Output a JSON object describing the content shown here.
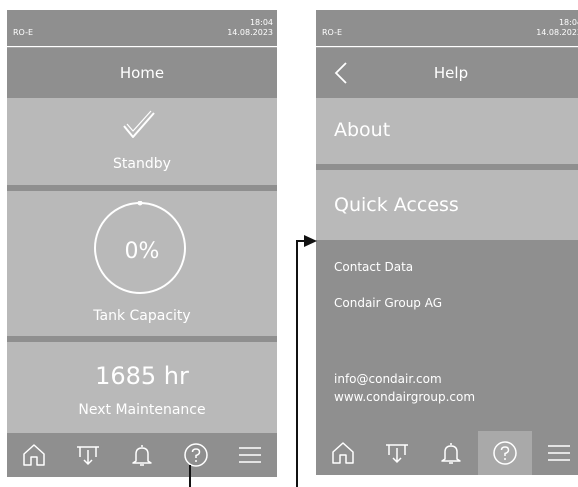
{
  "left_screen": {
    "status": {
      "model": "RO-E",
      "time": "18:04",
      "date": "14.08.2023"
    },
    "title": "Home",
    "standby_label": "Standby",
    "tank": {
      "value": "0%",
      "label": "Tank Capacity",
      "fill_fraction": 0.0
    },
    "maintenance": {
      "value": "1685 hr",
      "label": "Next Maintenance"
    },
    "nav": [
      "home-icon",
      "filter-icon",
      "bell-icon",
      "help-icon",
      "menu-icon"
    ],
    "active_nav": "help-icon"
  },
  "right_screen": {
    "status": {
      "model": "RO-E",
      "time": "18:04",
      "date": "14.08.2023"
    },
    "title": "Help",
    "menu": [
      "About",
      "Quick Access"
    ],
    "contact": {
      "heading": "Contact Data",
      "company": "Condair Group AG",
      "email": "info@condair.com",
      "web": "www.condairgroup.com"
    },
    "nav": [
      "home-icon",
      "filter-icon",
      "bell-icon",
      "help-icon",
      "menu-icon"
    ],
    "active_nav": "help-icon"
  },
  "colors": {
    "dark_grey": "#8f8f8f",
    "light_grey": "#b9b9b9",
    "active_grey": "#a9a9a9",
    "text": "#ffffff",
    "pointer": "#111111"
  }
}
